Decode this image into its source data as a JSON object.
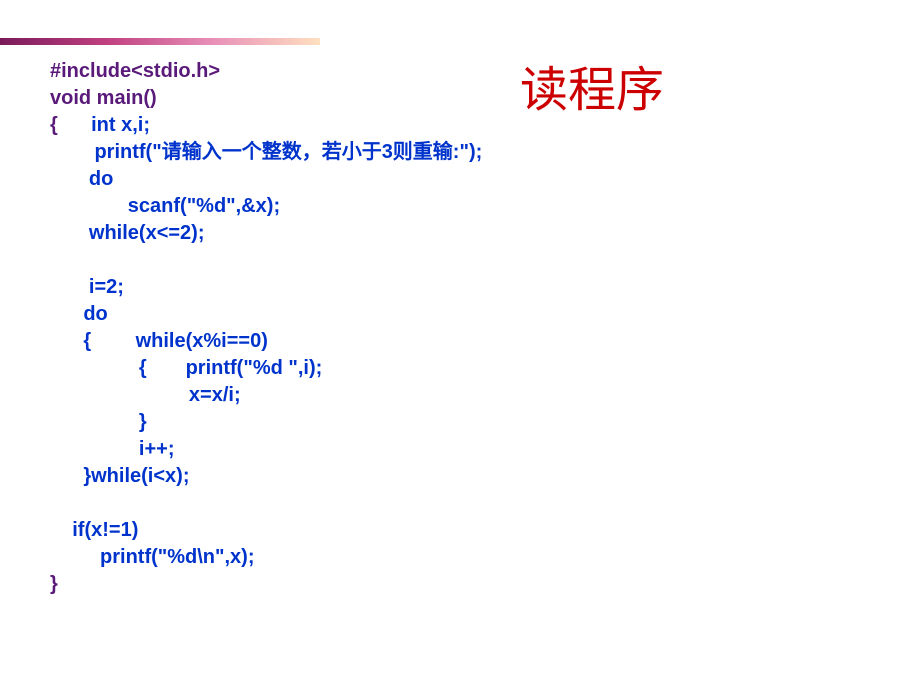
{
  "title": "读程序",
  "code": {
    "line1": "#include<stdio.h>",
    "line2": "void main()",
    "line3_a": "{      ",
    "line3_b": "int x,i;",
    "line4": "        printf(\"请输入一个整数，若小于3则重输:\");",
    "line5": "       do",
    "line6": "              scanf(\"%d\",&x);",
    "line7": "       while(x<=2);",
    "line8": "",
    "line9": "       i=2;",
    "line10": "      do",
    "line11": "      {        while(x%i==0)",
    "line12": "                {       printf(\"%d \",i);",
    "line13": "                         x=x/i;",
    "line14": "                }",
    "line15": "                i++;",
    "line16": "      }while(i<x);",
    "line17": "",
    "line18": "    if(x!=1)",
    "line19": "         printf(\"%d\\n\",x);",
    "line20": "}"
  }
}
